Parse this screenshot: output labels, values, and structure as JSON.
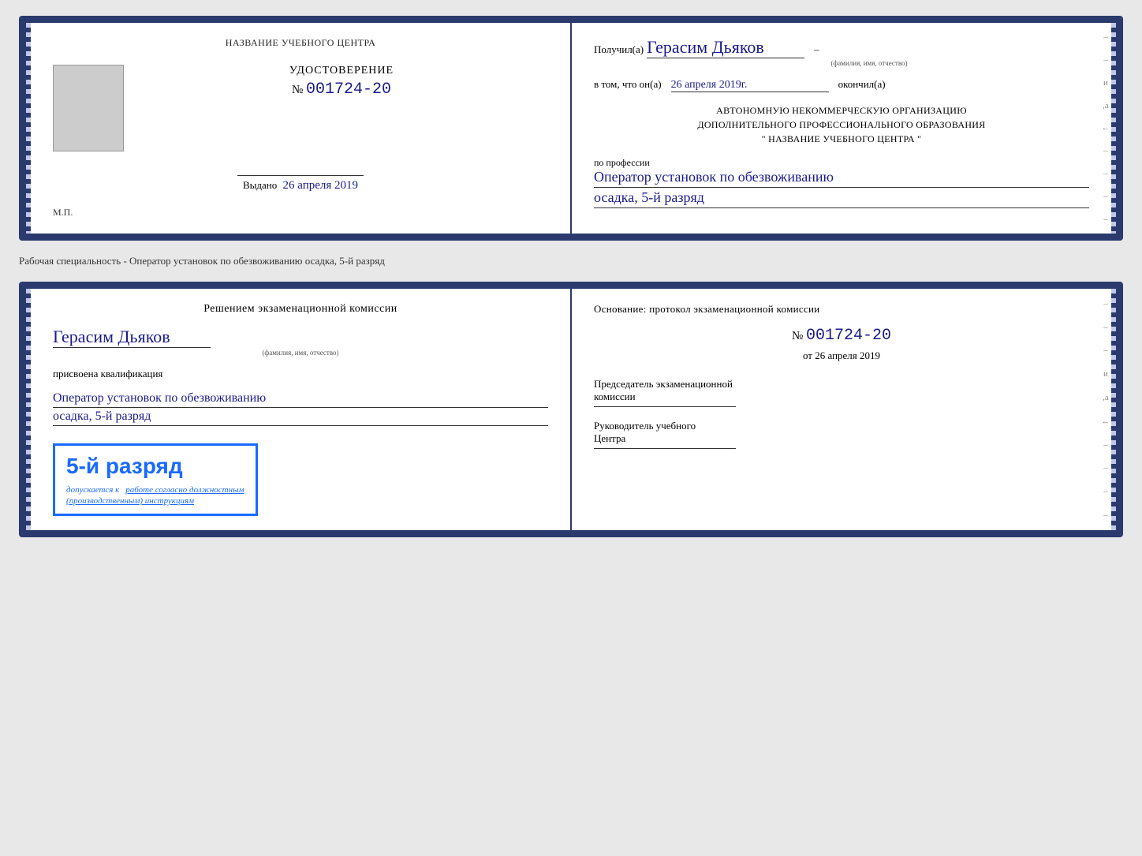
{
  "cert1": {
    "left": {
      "school_name_label": "НАЗВАНИЕ УЧЕБНОГО ЦЕНТРА",
      "cert_label": "УДОСТОВЕРЕНИЕ",
      "cert_number_prefix": "№",
      "cert_number": "001724-20",
      "issued_label": "Выдано",
      "issued_date": "26 апреля 2019",
      "mp_label": "М.П."
    },
    "right": {
      "received_prefix": "Получил(а)",
      "recipient_name": "Герасим Дьяков",
      "recipient_sublabel": "(фамилия, имя, отчество)",
      "dash": "–",
      "in_that_prefix": "в том, что он(а)",
      "date_handwritten": "26 апреля 2019г.",
      "finished_label": "окончил(а)",
      "org_line1": "АВТОНОМНУЮ НЕКОММЕРЧЕСКУЮ ОРГАНИЗАЦИЮ",
      "org_line2": "ДОПОЛНИТЕЛЬНОГО ПРОФЕССИОНАЛЬНОГО ОБРАЗОВАНИЯ",
      "org_line3": "\"   НАЗВАНИЕ УЧЕБНОГО ЦЕНТРА   \"",
      "profession_label": "по профессии",
      "profession_line1": "Оператор установок по обезвоживанию",
      "profession_line2": "осадка, 5-й разряд"
    }
  },
  "info_row": {
    "text": "Рабочая специальность - Оператор установок по обезвоживанию осадка, 5-й разряд"
  },
  "cert2": {
    "left": {
      "decision_label": "Решением экзаменационной комиссии",
      "recipient_name": "Герасим Дьяков",
      "recipient_sublabel": "(фамилия, имя, отчество)",
      "assigned_label": "присвоена квалификация",
      "qualification_line1": "Оператор установок по обезвоживанию",
      "qualification_line2": "осадка, 5-й разряд",
      "stamp_grade": "5-й разряд",
      "allowed_prefix": "допускается к",
      "allowed_underline": "работе согласно должностным",
      "allowed_suffix": "(производственным) инструкциям"
    },
    "right": {
      "basis_label": "Основание: протокол экзаменационной комиссии",
      "number_prefix": "№",
      "number": "001724-20",
      "date_prefix": "от",
      "date": "26 апреля 2019",
      "dash1": "–",
      "commission_chair_label": "Председатель экзаменационной",
      "commission_chair_label2": "комиссии",
      "center_head_label": "Руководитель учебного",
      "center_head_label2": "Центра"
    }
  }
}
